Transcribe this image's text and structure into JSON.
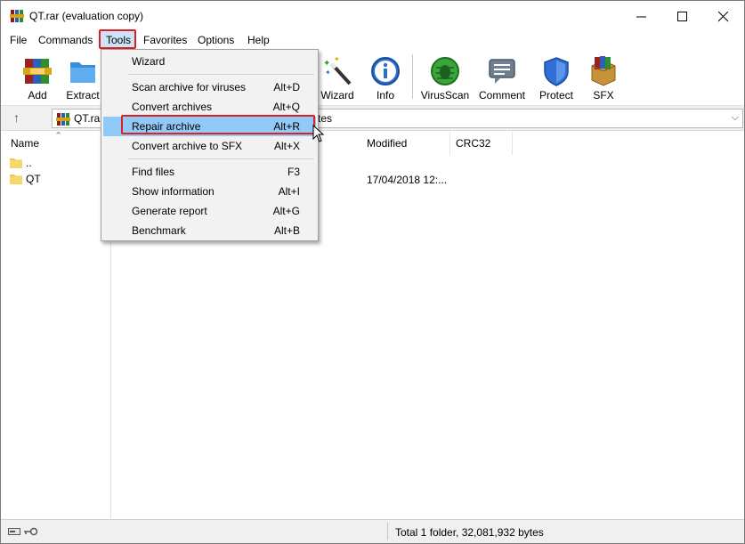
{
  "window": {
    "title": "QT.rar (evaluation copy)",
    "minimize_glyph": "—",
    "maximize_glyph": "☐",
    "close_glyph": "✕"
  },
  "menubar": {
    "items": [
      "File",
      "Commands",
      "Tools",
      "Favorites",
      "Options",
      "Help"
    ],
    "active": "Tools"
  },
  "toolbar": {
    "buttons": [
      {
        "label": "Add",
        "icon": "add-archive-icon"
      },
      {
        "label": "Extract",
        "icon": "extract-folder-icon"
      },
      {
        "label": "Wizard",
        "icon": "wizard-wand-icon"
      },
      {
        "label": "Info",
        "icon": "info-icon"
      },
      {
        "label": "VirusScan",
        "icon": "virus-scan-icon"
      },
      {
        "label": "Comment",
        "icon": "comment-icon"
      },
      {
        "label": "Protect",
        "icon": "shield-icon"
      },
      {
        "label": "SFX",
        "icon": "sfx-box-icon"
      }
    ]
  },
  "addressbar": {
    "path": "QT.rar",
    "path_tail": "tes",
    "up_glyph": "↑",
    "dropdown_glyph": "⌵"
  },
  "filelist": {
    "columns": [
      "Name",
      "Modified",
      "CRC32"
    ],
    "rows": [
      {
        "name": "..",
        "modified": ""
      },
      {
        "name": "QT",
        "modified": "17/04/2018 12:..."
      }
    ]
  },
  "tools_menu": {
    "groups": [
      [
        {
          "label": "Wizard",
          "shortcut": ""
        }
      ],
      [
        {
          "label": "Scan archive for viruses",
          "shortcut": "Alt+D"
        },
        {
          "label": "Convert archives",
          "shortcut": "Alt+Q"
        },
        {
          "label": "Repair archive",
          "shortcut": "Alt+R",
          "highlighted": true
        },
        {
          "label": "Convert archive to SFX",
          "shortcut": "Alt+X"
        }
      ],
      [
        {
          "label": "Find files",
          "shortcut": "F3"
        },
        {
          "label": "Show information",
          "shortcut": "Alt+I"
        },
        {
          "label": "Generate report",
          "shortcut": "Alt+G"
        },
        {
          "label": "Benchmark",
          "shortcut": "Alt+B"
        }
      ]
    ]
  },
  "statusbar": {
    "text": "Total 1 folder, 32,081,932 bytes"
  },
  "colors": {
    "highlight": "#91c9f7",
    "annotation_red": "#e02020",
    "menu_bg": "#f2f2f2"
  }
}
